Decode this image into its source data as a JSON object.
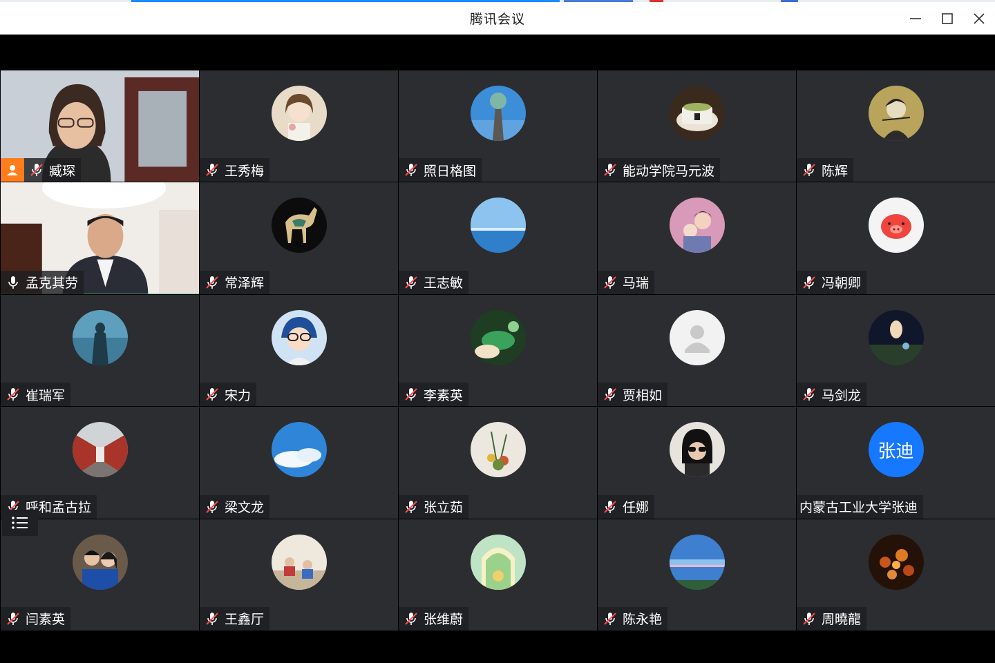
{
  "window": {
    "title": "腾讯会议",
    "buttons": {
      "minimize": "minimize-icon",
      "maximize": "maximize-icon",
      "close": "close-icon"
    }
  },
  "colors": {
    "muted_icon": "#ffffff",
    "active_speaker_border": "#24b25b",
    "host_badge": "#ff7d1a",
    "text_avatar_bg": "#1677ff"
  },
  "participants": [
    {
      "name": "臧琛",
      "mic": "muted",
      "host": true,
      "video": "woman-glasses"
    },
    {
      "name": "王秀梅",
      "mic": "muted",
      "avatar": "anime-girl"
    },
    {
      "name": "照日格图",
      "mic": "muted",
      "avatar": "sculpture-sky"
    },
    {
      "name": "能动学院马元波",
      "mic": "muted",
      "avatar": "coffee-cup"
    },
    {
      "name": "陈辉",
      "mic": "muted",
      "avatar": "sketch-portrait"
    },
    {
      "name": "孟克其劳",
      "mic": "on",
      "active": true,
      "video": "man-suit"
    },
    {
      "name": "常泽辉",
      "mic": "muted",
      "avatar": "tang-horse"
    },
    {
      "name": "王志敏",
      "mic": "muted",
      "avatar": "sea-horizon"
    },
    {
      "name": "马瑞",
      "mic": "muted",
      "avatar": "mother-child"
    },
    {
      "name": "冯朝卿",
      "mic": "muted",
      "avatar": "pig-cartoon"
    },
    {
      "name": "崔瑞军",
      "mic": "muted",
      "avatar": "silhouette-blue"
    },
    {
      "name": "宋力",
      "mic": "muted",
      "avatar": "anime-boy"
    },
    {
      "name": "李素英",
      "mic": "muted",
      "avatar": "green-tea"
    },
    {
      "name": "贾相如",
      "mic": "muted",
      "avatar": "default-user"
    },
    {
      "name": "马剑龙",
      "mic": "muted",
      "avatar": "night-moon"
    },
    {
      "name": "呼和孟古拉",
      "mic": "muted",
      "avatar": "red-corridor"
    },
    {
      "name": "梁文龙",
      "mic": "muted",
      "avatar": "blue-sky-clouds"
    },
    {
      "name": "张立茹",
      "mic": "muted",
      "avatar": "flower-arrangement"
    },
    {
      "name": "任娜",
      "mic": "muted",
      "avatar": "sunglasses-woman"
    },
    {
      "name": "内蒙古工业大学张迪",
      "mic": "none",
      "avatar_text": "张迪"
    },
    {
      "name": "闫素英",
      "mic": "muted",
      "avatar": "couple-selfie"
    },
    {
      "name": "王鑫厅",
      "mic": "muted",
      "avatar": "kids-room"
    },
    {
      "name": "张维蔚",
      "mic": "muted",
      "avatar": "garden-arch"
    },
    {
      "name": "陈永艳",
      "mic": "muted",
      "avatar": "sky-rainbow"
    },
    {
      "name": "周曉龍",
      "mic": "muted",
      "avatar": "campfire"
    }
  ],
  "overlay": {
    "list_toggle_icon": "list-icon"
  }
}
